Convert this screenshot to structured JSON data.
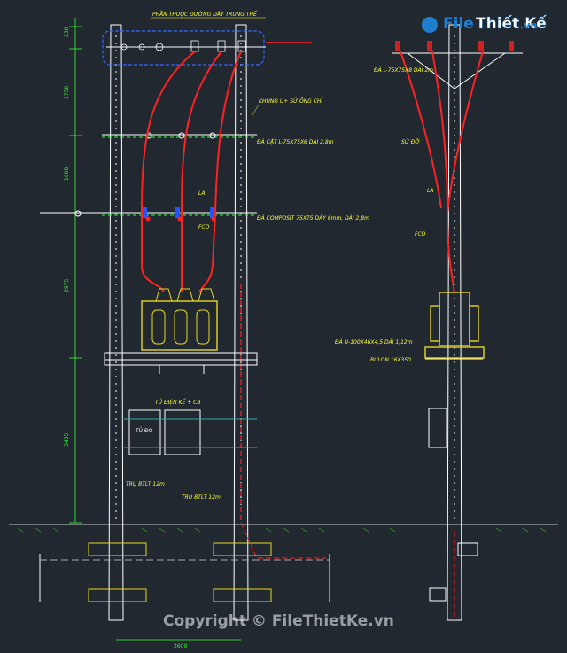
{
  "logo": {
    "brand_a": "File",
    "brand_b": "Thiết Kế",
    "domain": ".vn"
  },
  "watermark": "Copyright © FileThietKe.vn",
  "colors": {
    "background": "#212830",
    "annotation": "#ffff33",
    "dimension": "#33ff33",
    "wire": "#ff2222",
    "equipment": "#e8d820",
    "pole": "#ffffff"
  },
  "front_view": {
    "label_line_section": "PHẦN THUỘC ĐƯỜNG DÂY TRUNG THẾ",
    "label_frame": "KHUNG U+ SỨ ỐNG CHỈ",
    "label_crossarm_l": "ĐÀ CẶT L-75X75X6 DÀI 2,8m",
    "label_composite": "ĐÀ COMPOSIT 75X75 DÀY 6mm, DÀI 2,8m",
    "label_la": "LA",
    "label_fco": "FCO",
    "label_meter_cabinet": "TỦ ĐIỆN KẾ + CB",
    "label_cabinet_box": "TỦ ĐO",
    "label_pole_a": "TRỤ BTLT 12m",
    "label_pole_b": "TRỤ BTLT 12m",
    "dimensions": [
      "230",
      "1750",
      "1600",
      "2975",
      "3435"
    ],
    "span": "2600"
  },
  "side_view": {
    "label_crossarm": "ĐÀ L-75X75X8 DÀI 2m",
    "label_insulator": "SỨ ĐỠ",
    "label_la": "LA",
    "label_fco": "FCO",
    "label_u_beam": "ĐÀ U-100X46X4,5 DÀI 1,12m",
    "label_bolt": "BULON 16X350"
  }
}
